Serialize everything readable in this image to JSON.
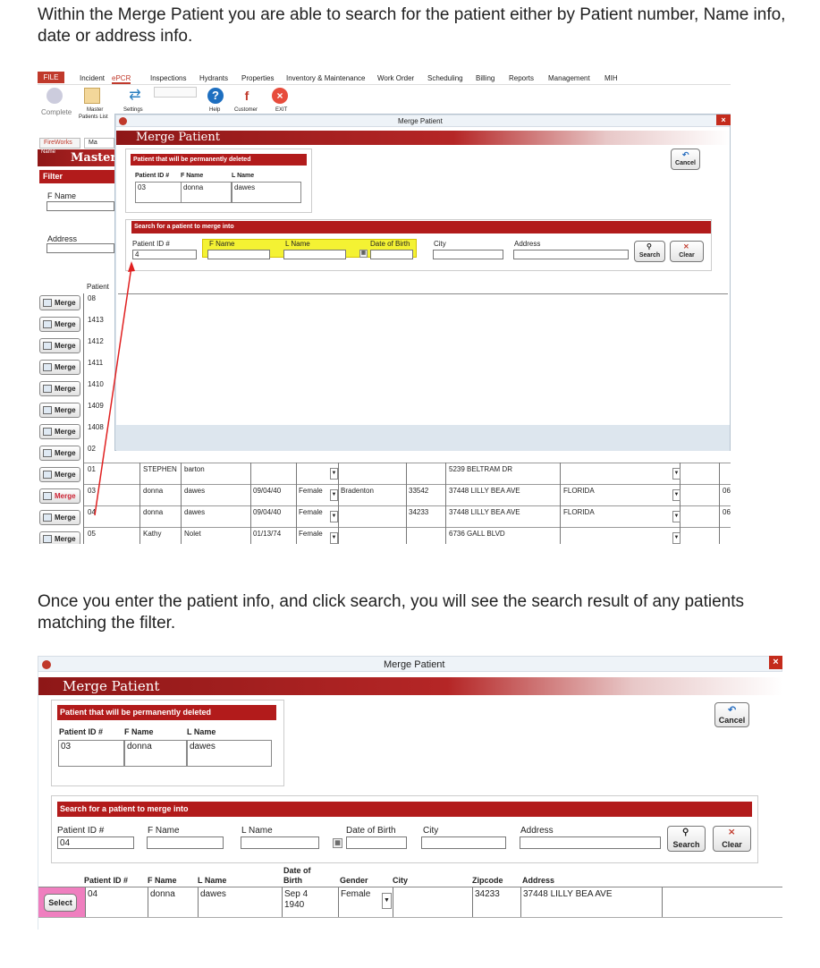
{
  "intro_text": "Within the Merge Patient you are able to search for the patient either by Patient number, Name info, date or address info.",
  "result_text": "Once you enter the patient info, and click search, you will see the search result of any patients matching the filter.",
  "shot1": {
    "menu": [
      "FILE",
      "Incident",
      "ePCR",
      "Inspections",
      "Hydrants",
      "Properties",
      "Inventory & Maintenance",
      "Work Order",
      "Scheduling",
      "Billing",
      "Reports",
      "Management",
      "MIH"
    ],
    "ribbon": {
      "complete": "Complete",
      "master": "Master",
      "patients_list": "Patients List",
      "settings": "Settings",
      "help": "Help",
      "customer": "Customer",
      "exit": "EXIT"
    },
    "tabs": [
      "FireWorks",
      "Ma"
    ],
    "master_title": "Master",
    "name_tag": "Name",
    "filter": "Filter",
    "f_name": "F Name",
    "address": "Address",
    "patient_col": "Patient",
    "merge_label": "Merge",
    "bg_ids": [
      "08",
      "1413",
      "1412",
      "1411",
      "1410",
      "1409",
      "1408",
      "02"
    ],
    "bg_rows": [
      {
        "id": "01",
        "fname": "STEPHEN",
        "lname": "barton",
        "dob": "",
        "gender": "",
        "city": "",
        "zip": "",
        "address": "5239 BELTRAM DR",
        "state": ""
      },
      {
        "id": "03",
        "fname": "donna",
        "lname": "dawes",
        "dob": "09/04/40",
        "gender": "Female",
        "city": "Bradenton",
        "zip": "33542",
        "address": "37448 LILLY BEA AVE",
        "state": "FLORIDA"
      },
      {
        "id": "04",
        "fname": "donna",
        "lname": "dawes",
        "dob": "09/04/40",
        "gender": "Female",
        "city": "",
        "zip": "34233",
        "address": "37448 LILLY BEA AVE",
        "state": "FLORIDA"
      },
      {
        "id": "05",
        "fname": "Kathy",
        "lname": "Nolet",
        "dob": "01/13/74",
        "gender": "Female",
        "city": "",
        "zip": "",
        "address": "6736 GALL BLVD",
        "state": ""
      }
    ],
    "row_tail": "06",
    "dialog": {
      "window_title": "Merge Patient",
      "banner": "Merge Patient",
      "deleted_header": "Patient that will be permanently deleted",
      "col_id": "Patient ID #",
      "col_fname": "F Name",
      "col_lname": "L Name",
      "deleted": {
        "id": "03",
        "fname": "donna",
        "lname": "dawes"
      },
      "cancel": "Cancel",
      "search_header": "Search for a patient to merge into",
      "search_labels": {
        "id": "Patient ID #",
        "fname": "F Name",
        "lname": "L Name",
        "dob": "Date of Birth",
        "city": "City",
        "address": "Address"
      },
      "search_id_value": "4",
      "search_btn": "Search",
      "clear_btn": "Clear"
    }
  },
  "shot2": {
    "window_title": "Merge Patient",
    "banner": "Merge Patient",
    "deleted_header": "Patient that will be permanently deleted",
    "col_id": "Patient ID #",
    "col_fname": "F Name",
    "col_lname": "L Name",
    "deleted": {
      "id": "03",
      "fname": "donna",
      "lname": "dawes"
    },
    "cancel": "Cancel",
    "search_header": "Search for a patient to merge into",
    "search_labels": {
      "id": "Patient ID #",
      "fname": "F Name",
      "lname": "L Name",
      "dob": "Date of Birth",
      "city": "City",
      "address": "Address"
    },
    "search_id_value": "04",
    "search_btn": "Search",
    "clear_btn": "Clear",
    "result_headers": {
      "id": "Patient ID #",
      "fname": "F Name",
      "lname": "L Name",
      "dob1": "Date of",
      "dob2": "Birth",
      "gender": "Gender",
      "city": "City",
      "zip": "Zipcode",
      "address": "Address"
    },
    "result": {
      "select": "Select",
      "id": "04",
      "fname": "donna",
      "lname": "dawes",
      "dob1": "Sep  4",
      "dob2": "1940",
      "gender": "Female",
      "city": "",
      "zip": "34233",
      "address": "37448  LILLY BEA AVE"
    }
  },
  "colors": {
    "dialog_red": "#b21b1b",
    "highlight_yellow": "#f4f233",
    "arrow_red": "#e02020",
    "select_pink": "#ef7fbf"
  }
}
